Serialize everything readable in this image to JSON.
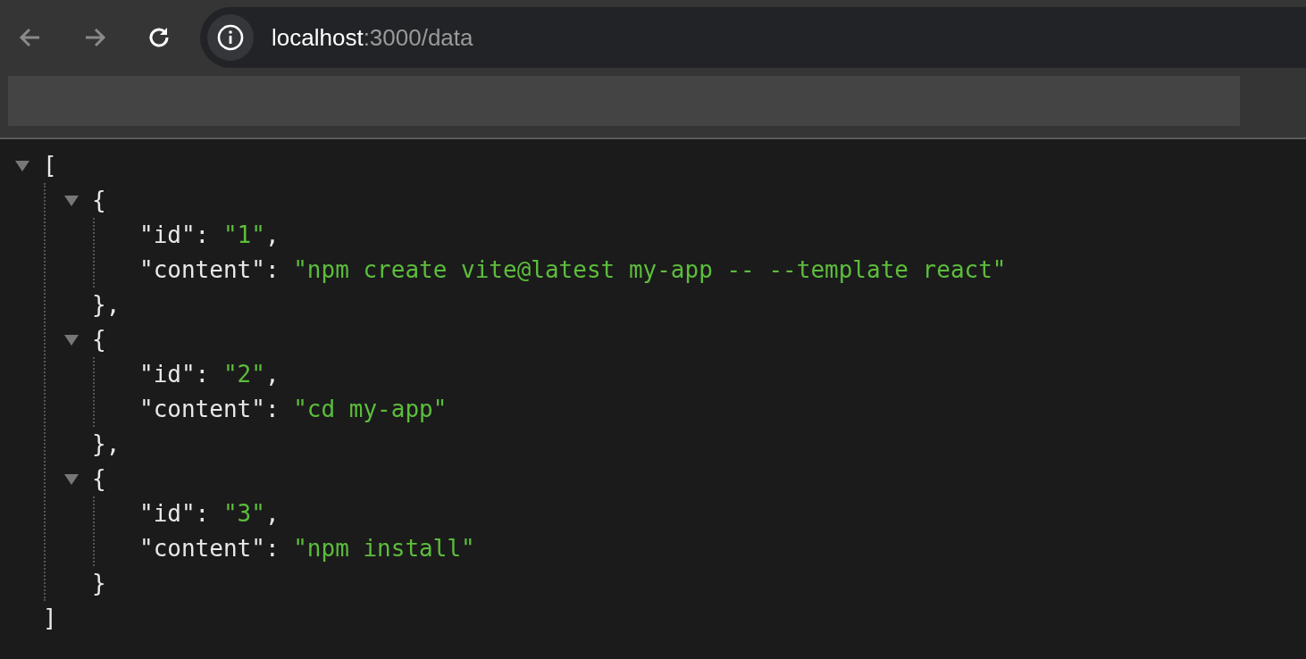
{
  "browser": {
    "back": {
      "disabled": true
    },
    "forward": {
      "disabled": true
    },
    "url_host": "localhost",
    "url_rest": ":3000/data"
  },
  "viewer": {
    "open": "[",
    "close": "]",
    "expanded": true,
    "children": [
      {
        "open": "{",
        "close": "},",
        "expanded": true,
        "props": [
          {
            "key": "\"id\":",
            "value": "\"1\"",
            "punct": ","
          },
          {
            "key": "\"content\":",
            "value": "\"npm create vite@latest my-app -- --template react\""
          }
        ]
      },
      {
        "open": "{",
        "close": "},",
        "expanded": true,
        "props": [
          {
            "key": "\"id\":",
            "value": "\"2\"",
            "punct": ","
          },
          {
            "key": "\"content\":",
            "value": "\"cd my-app\""
          }
        ]
      },
      {
        "open": "{",
        "close": "}",
        "expanded": true,
        "props": [
          {
            "key": "\"id\":",
            "value": "\"3\"",
            "punct": ","
          },
          {
            "key": "\"content\":",
            "value": "\"npm install\""
          }
        ]
      }
    ]
  }
}
